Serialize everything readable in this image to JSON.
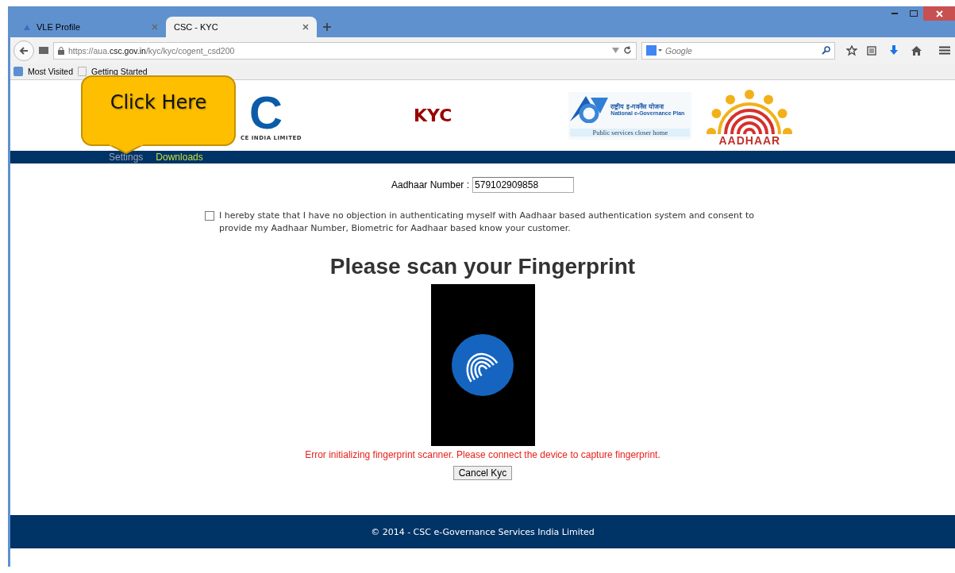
{
  "browser": {
    "tabs": [
      {
        "label": "VLE Profile",
        "selected": false
      },
      {
        "label": "CSC - KYC",
        "selected": true
      }
    ],
    "address": {
      "prefix": "https://aua.",
      "domain": "csc.gov.in",
      "path": "/kyc/kyc/cogent_csd200"
    },
    "search": {
      "placeholder": "Google"
    },
    "bookmarks": [
      "Most Visited",
      "Getting Started"
    ]
  },
  "header": {
    "csc_letter": "C",
    "csc_tagline": "CE INDIA LIMITED",
    "title": "KYC",
    "egov_hindi": "राष्ट्रीय इ-गवर्नेंस योजना",
    "egov_name": "National e-Governance Plan",
    "egov_slogan": "Public services closer home",
    "aadhaar": "AADHAAR"
  },
  "nav": [
    {
      "label": "Settings",
      "selected": false
    },
    {
      "label": "Downloads",
      "selected": true
    }
  ],
  "callout": {
    "text": "Click Here"
  },
  "form": {
    "aadhaar_label": "Aadhaar Number :",
    "aadhaar_value": "579102909858",
    "consent": {
      "checked": false,
      "text": "I hereby state that I have no objection in authenticating myself with Aadhaar based authentication system and consent to provide my Aadhaar Number, Biometric for Aadhaar based know your customer."
    },
    "heading": "Please scan your Fingerprint",
    "error": "Error initializing fingerprint scanner. Please connect the device to capture fingerprint.",
    "cancel": "Cancel Kyc"
  },
  "footer": {
    "text": "© 2014 - CSC e-Governance Services India Limited"
  }
}
